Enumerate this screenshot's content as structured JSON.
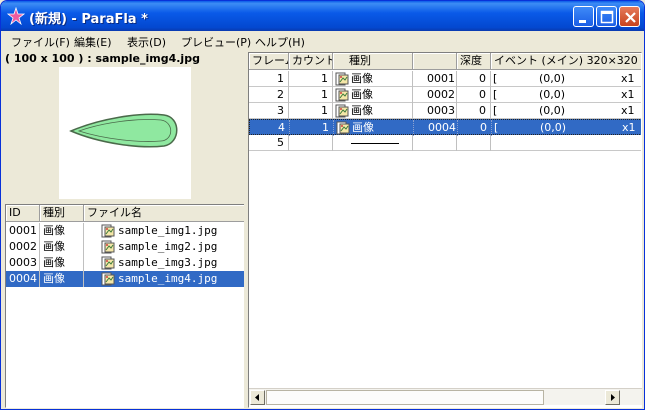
{
  "window": {
    "title": "(新規) - ParaFla *",
    "controls": [
      "minimize",
      "maximize",
      "close"
    ]
  },
  "menu": [
    {
      "label": "ファイル(F)"
    },
    {
      "label": "編集(E)"
    },
    {
      "label": "表示(D)"
    },
    {
      "label": "プレビュー(P)"
    },
    {
      "label": "ヘルプ(H)"
    }
  ],
  "preview": {
    "caption": "( 100 x 100 ) : sample_img4.jpg",
    "shape_fill": "#8fe8a0",
    "shape_stroke": "#4a6a4a"
  },
  "asset_list": {
    "headers": {
      "id": "ID",
      "type": "種別",
      "file": "ファイル名"
    },
    "rows": [
      {
        "id": "0001",
        "type": "画像",
        "file": "sample_img1.jpg",
        "selected": false
      },
      {
        "id": "0002",
        "type": "画像",
        "file": "sample_img2.jpg",
        "selected": false
      },
      {
        "id": "0003",
        "type": "画像",
        "file": "sample_img3.jpg",
        "selected": false
      },
      {
        "id": "0004",
        "type": "画像",
        "file": "sample_img4.jpg",
        "selected": true
      }
    ]
  },
  "timeline": {
    "headers": {
      "frame": "フレーム",
      "count": "カウント",
      "type": "種別",
      "id": "",
      "depth": "深度",
      "event": "イベント (メイン)  320×320"
    },
    "rows": [
      {
        "frame": "1",
        "count": "1",
        "type": "画像",
        "id": "0001",
        "depth": "0",
        "event_open": "[",
        "coords": "(0,0)",
        "scale": "x1",
        "selected": false
      },
      {
        "frame": "2",
        "count": "1",
        "type": "画像",
        "id": "0002",
        "depth": "0",
        "event_open": "[",
        "coords": "(0,0)",
        "scale": "x1",
        "selected": false
      },
      {
        "frame": "3",
        "count": "1",
        "type": "画像",
        "id": "0003",
        "depth": "0",
        "event_open": "[",
        "coords": "(0,0)",
        "scale": "x1",
        "selected": false
      },
      {
        "frame": "4",
        "count": "1",
        "type": "画像",
        "id": "0004",
        "depth": "0",
        "event_open": "[",
        "coords": "(0,0)",
        "scale": "x1",
        "selected": true
      },
      {
        "frame": "5",
        "count": "",
        "type": "",
        "id": "",
        "depth": "",
        "event_open": "",
        "coords": "",
        "scale": "",
        "selected": false
      }
    ]
  },
  "colors": {
    "selection": "#316ac5",
    "titlebar": "#0a5ae8",
    "close": "#c8431d"
  }
}
